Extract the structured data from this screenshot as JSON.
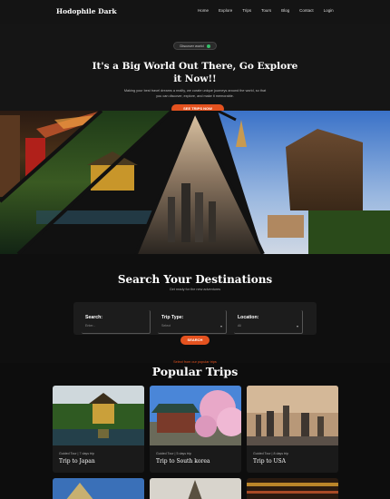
{
  "nav": {
    "logo": "Hodophile Dark",
    "links": [
      "Home",
      "Explore",
      "Trips",
      "Tours",
      "Blog",
      "Contact",
      "Login"
    ]
  },
  "hero": {
    "badge": "Discover world",
    "title": "It's a Big World Out There, Go Explore it Now!!",
    "description": "Making your best travel dreams a reality, we curate unique journeys around the world, so that you can discover, explore, and make it memorable.",
    "button": "SEE TRIPS NOW"
  },
  "search": {
    "title": "Search Your Destinations",
    "subtitle": "Get ready for the new adventures",
    "fields": [
      {
        "label": "Search:",
        "value": "Enter..."
      },
      {
        "label": "Trip Type:",
        "value": "Select"
      },
      {
        "label": "Location:",
        "value": "All"
      }
    ],
    "button": "SEARCH"
  },
  "popular": {
    "subtitle": "Select from our popular trips",
    "title": "Popular Trips",
    "cards": [
      {
        "meta": "Guided Tour  |  7 days trip",
        "name": "Trip to Japan"
      },
      {
        "meta": "Guided Tour  |  5 days trip",
        "name": "Trip to South korea"
      },
      {
        "meta": "Guided Tour  |  8 days trip",
        "name": "Trip to USA"
      }
    ]
  },
  "colors": {
    "accent": "#e4521f",
    "background": "#0d0d0d"
  }
}
